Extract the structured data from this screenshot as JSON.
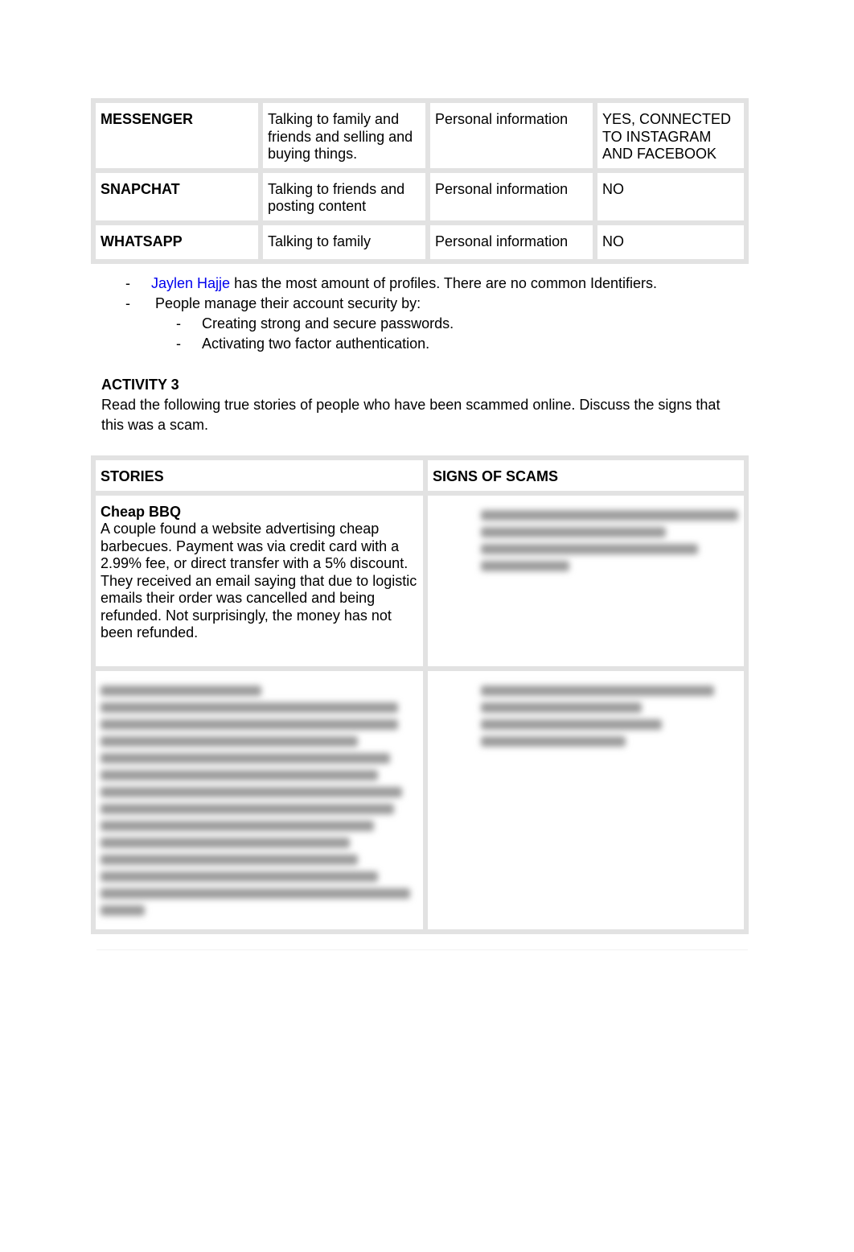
{
  "profiles_table": {
    "rows": [
      {
        "app": "MESSENGER",
        "use": "Talking to family and friends and selling and buying things.",
        "info": "Personal information",
        "connected": "YES, CONNECTED TO INSTAGRAM AND FACEBOOK"
      },
      {
        "app": "SNAPCHAT",
        "use": "Talking to friends and posting content",
        "info": "Personal information",
        "connected": "NO"
      },
      {
        "app": "WHATSAPP",
        "use": "Talking to family",
        "info": "Personal information",
        "connected": "NO"
      }
    ]
  },
  "notes": {
    "bullet1_name": "Jaylen Hajje",
    "bullet1_rest": " has the most amount of profiles. There are no common Identifiers.",
    "bullet2": "People manage their account security by:",
    "sub1": "Creating strong and secure passwords.",
    "sub2": "Activating two factor authentication.",
    "dash": "-"
  },
  "activity": {
    "title": "ACTIVITY 3",
    "instructions": "Read the following true stories of people who have been scammed online. Discuss the signs that this was a scam."
  },
  "stories_table": {
    "headers": [
      "STORIES",
      "SIGNS OF SCAMS"
    ],
    "story1_title": "Cheap BBQ",
    "story1_text": "A couple found a website advertising cheap barbecues. Payment was via credit card with a 2.99% fee, or direct transfer with a 5% discount. They received an email saying that due to logistic emails their order was cancelled and being refunded. Not surprisingly, the money has not been refunded."
  }
}
